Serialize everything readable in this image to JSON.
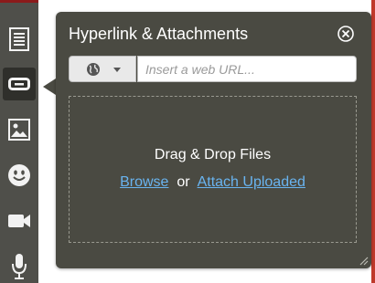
{
  "sidebar": {
    "tools": [
      {
        "icon": "document-lines-icon"
      },
      {
        "icon": "link-icon",
        "active": true
      },
      {
        "icon": "image-icon"
      },
      {
        "icon": "smiley-icon"
      },
      {
        "icon": "video-camera-icon"
      },
      {
        "icon": "microphone-icon"
      }
    ]
  },
  "popup": {
    "title": "Hyperlink & Attachments",
    "close_icon": "close-circle-icon",
    "link_type_icon": "globe-icon",
    "url_placeholder": "Insert a web URL...",
    "url_value": "",
    "dropzone": {
      "title": "Drag & Drop Files",
      "browse_label": "Browse",
      "or_label": "or",
      "attach_label": "Attach Uploaded"
    }
  },
  "colors": {
    "sidebar_bg": "#4f4f4a",
    "popup_bg": "#4a4a42",
    "link": "#69b4f0",
    "accent_red": "#c0392b"
  }
}
